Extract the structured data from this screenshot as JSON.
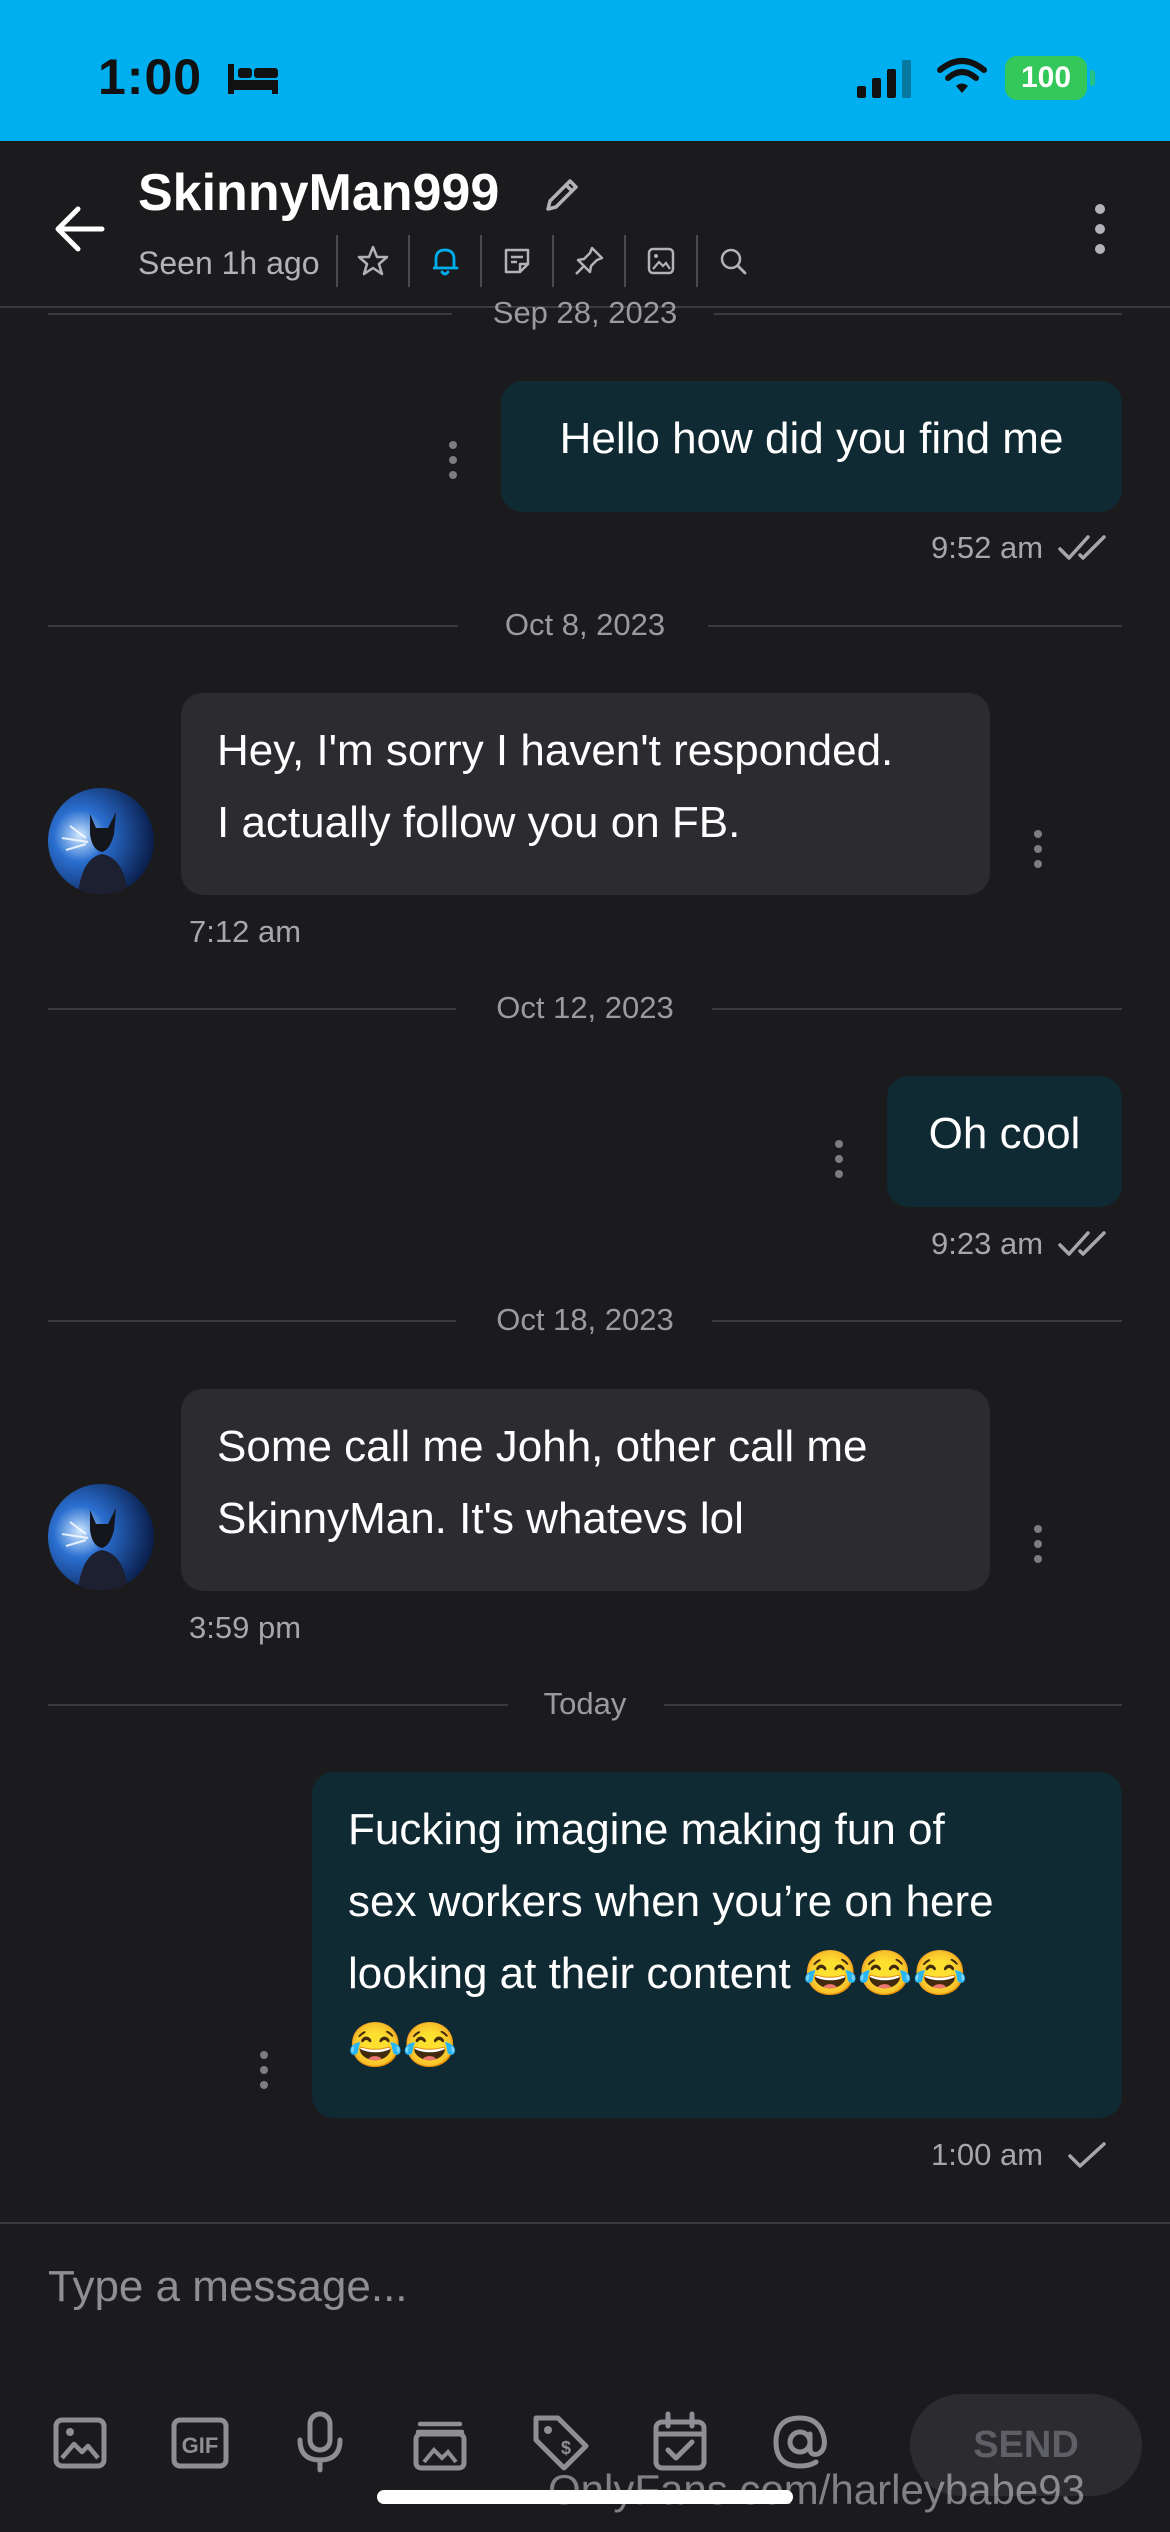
{
  "status_bar": {
    "time": "1:00",
    "battery": "100",
    "bg_color": "#00aff0"
  },
  "header": {
    "name": "SkinnyMan999",
    "seen": "Seen 1h ago",
    "tools": [
      "star-icon",
      "bell-icon",
      "note-icon",
      "pin-icon",
      "gallery-icon",
      "search-icon"
    ]
  },
  "messages": [
    {
      "date": "Sep 28, 2023",
      "direction": "outgoing",
      "text": "Hello how did you find me",
      "time": "9:52 am",
      "status": "read"
    },
    {
      "date": "Oct 8, 2023",
      "direction": "incoming",
      "line1": "Hey, I'm sorry I haven't responded.",
      "line2": "I actually follow you on FB.",
      "time": "7:12 am"
    },
    {
      "date": "Oct 12, 2023",
      "direction": "outgoing",
      "text": "Oh cool",
      "time": "9:23 am",
      "status": "read"
    },
    {
      "date": "Oct 18, 2023",
      "direction": "incoming",
      "line1": "Some call me Johh, other call me",
      "line2": "SkinnyMan. It's whatevs lol",
      "time": "3:59 pm"
    },
    {
      "date": "Today",
      "direction": "outgoing",
      "line1": "Fucking imagine making fun of",
      "line2": "sex workers when you’re on here",
      "line3": "looking at their content 😂😂😂",
      "line4": "😂😂",
      "time": "1:00 am",
      "status": "sent"
    }
  ],
  "composer": {
    "placeholder": "Type a message...",
    "send_label": "SEND",
    "tools": [
      "image-icon",
      "gif-icon",
      "microphone-icon",
      "vault-icon",
      "price-tag-icon",
      "schedule-icon",
      "mention-icon"
    ]
  },
  "watermark": "OnlyFans.com/harleybabe93",
  "colors": {
    "accent": "#00aff0",
    "outgoing_bubble": "#0f2a33",
    "incoming_bubble": "#2b2b30",
    "background": "#1b1b1e"
  }
}
